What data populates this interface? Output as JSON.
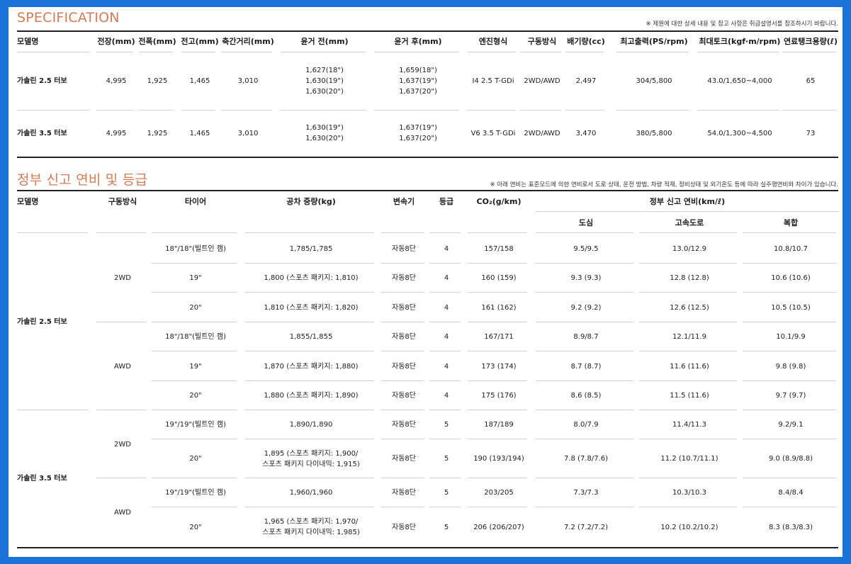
{
  "spec": {
    "title": "SPECIFICATION",
    "note": "※ 제원에 대한 상세 내용 및 참고 사항은 취급설명서를 참조하시기 바랍니다.",
    "headers": [
      "모델명",
      "전장(mm)",
      "전폭(mm)",
      "전고(mm)",
      "축간거리(mm)",
      "윤거 전(mm)",
      "윤거 후(mm)",
      "엔진형식",
      "구동방식",
      "배기량(cc)",
      "최고출력(PS/rpm)",
      "최대토크(kgf·m/rpm)",
      "연료탱크용량(ℓ)"
    ],
    "rows": [
      [
        "가솔린 2.5 터보",
        "4,995",
        "1,925",
        "1,465",
        "3,010",
        "1,627(18\")\n1,630(19\")\n1,630(20\")",
        "1,659(18\")\n1,637(19\")\n1,637(20\")",
        "I4 2.5 T-GDi",
        "2WD/AWD",
        "2,497",
        "304/5,800",
        "43.0/1,650~4,000",
        "65"
      ],
      [
        "가솔린 3.5 터보",
        "4,995",
        "1,925",
        "1,465",
        "3,010",
        "1,630(19\")\n1,630(20\")",
        "1,637(19\")\n1,637(20\")",
        "V6 3.5 T-GDi",
        "2WD/AWD",
        "3,470",
        "380/5,800",
        "54.0/1,300~4,500",
        "73"
      ]
    ]
  },
  "fuel": {
    "title": "정부 신고 연비 및 등급",
    "note": "※ 아래 연비는 표준모드에 의한 연비로서 도로 상태, 운전 방법, 차량 적재, 정비상태 및 외기온도 등에 따라 실주행연비와 차이가 있습니다.",
    "headers": {
      "model": "모델명",
      "drive": "구동방식",
      "tire": "타이어",
      "weight": "공차 중량(kg)",
      "trans": "변속기",
      "grade": "등급",
      "co2": "CO₂(g/km)",
      "mileage": "정부 신고 연비(km/ℓ)",
      "city": "도심",
      "highway": "고속도로",
      "combined": "복합"
    },
    "models": [
      "가솔린 2.5 터보",
      "가솔린 3.5 터보"
    ],
    "drives": [
      "2WD",
      "AWD",
      "2WD",
      "AWD"
    ],
    "rows": [
      [
        "18\"/18\"(빌트인 캠)",
        "1,785/1,785",
        "자동8단",
        "4",
        "157/158",
        "9.5/9.5",
        "13.0/12.9",
        "10.8/10.7"
      ],
      [
        "19\"",
        "1,800 (스포츠 패키지: 1,810)",
        "자동8단",
        "4",
        "160 (159)",
        "9.3 (9.3)",
        "12.8 (12.8)",
        "10.6 (10.6)"
      ],
      [
        "20\"",
        "1,810 (스포츠 패키지: 1,820)",
        "자동8단",
        "4",
        "161 (162)",
        "9.2 (9.2)",
        "12.6 (12.5)",
        "10.5 (10.5)"
      ],
      [
        "18\"/18\"(빌트인 캠)",
        "1,855/1,855",
        "자동8단",
        "4",
        "167/171",
        "8.9/8.7",
        "12.1/11.9",
        "10.1/9.9"
      ],
      [
        "19\"",
        "1,870 (스포츠 패키지: 1,880)",
        "자동8단",
        "4",
        "173 (174)",
        "8.7 (8.7)",
        "11.6 (11.6)",
        "9.8 (9.8)"
      ],
      [
        "20\"",
        "1,880 (스포츠 패키지: 1,890)",
        "자동8단",
        "4",
        "175 (176)",
        "8.6 (8.5)",
        "11.5 (11.6)",
        "9.7 (9.7)"
      ],
      [
        "19\"/19\"(빌트인 캠)",
        "1,890/1,890",
        "자동8단",
        "5",
        "187/189",
        "8.0/7.9",
        "11.4/11.3",
        "9.2/9.1"
      ],
      [
        "20\"",
        "1,895 (스포츠 패키지: 1,900/\n스포츠 패키지 다이내믹: 1,915)",
        "자동8단",
        "5",
        "190 (193/194)",
        "7.8 (7.8/7.6)",
        "11.2 (10.7/11.1)",
        "9.0 (8.9/8.8)"
      ],
      [
        "19\"/19\"(빌트인 캠)",
        "1,960/1,960",
        "자동8단",
        "5",
        "203/205",
        "7.3/7.3",
        "10.3/10.3",
        "8.4/8.4"
      ],
      [
        "20\"",
        "1,965 (스포츠 패키지: 1,970/\n스포츠 패키지 다이내믹: 1,985)",
        "자동8단",
        "5",
        "206 (206/207)",
        "7.2 (7.2/7.2)",
        "10.2 (10.2/10.2)",
        "8.3 (8.3/8.3)"
      ]
    ]
  }
}
